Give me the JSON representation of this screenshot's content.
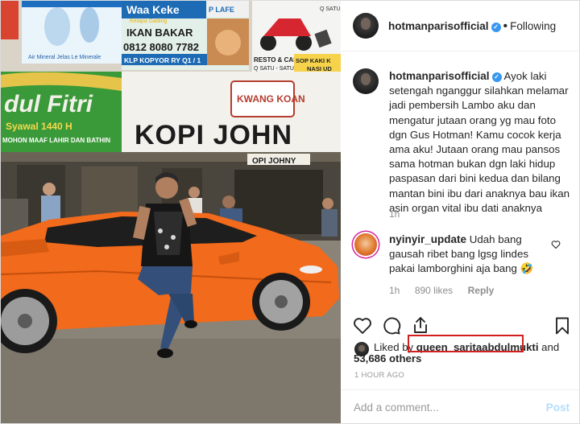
{
  "post": {
    "username": "hotmanparisofficial",
    "follow_state": "Following",
    "separator": "•",
    "caption": "Ayok laki setengah nganggur silahkan melamar jadi pembersih Lambo aku dan mengatur jutaan orang yg mau foto dgn Gus Hotman! Kamu cocok kerja ama aku! Jutaan orang mau pansos sama hotman bukan dgn laki hidup paspasan dari bini kedua dan bilang mantan bini ibu dari anaknya bau ikan asin organ vital ibu dati anaknya",
    "caption_time": "1h"
  },
  "comment": {
    "username": "nyinyir_update",
    "text": "Udah bang gausah ribet bang lgsg lindes pakai lamborghini aja bang",
    "emoji": "🤣",
    "time": "1h",
    "likes": "890 likes",
    "reply_label": "Reply"
  },
  "likes": {
    "prefix": "Liked by",
    "user": "queen_saritaabdulmukti",
    "connector": "and",
    "others": "53,686 others"
  },
  "timestamp": "1 HOUR AGO",
  "composer": {
    "placeholder": "Add a comment...",
    "post_label": "Post"
  },
  "photo": {
    "sign_top_1": "Waa Keke",
    "sign_top_2": "Kelapa Gading",
    "sign_top_3": "IKAN BAKAR",
    "sign_top_4": "0812 8080 7782",
    "sign_top_5": "KLP KOPYOR RY Q1 / 1",
    "sign_top_6": "Air Mineral Jelas Le Minerale",
    "sign_top_7": "RESTO & CAFE",
    "sign_top_8": "Q SATU - SATU",
    "sign_top_9": "SOP KAKI K",
    "sign_top_10": "NASI UD",
    "sign_top_11": "Q SATU",
    "sign_top_12": "P LAFE",
    "banner_1": "dul Fitri",
    "banner_2": "Syawal 1440 H",
    "banner_3": "MOHON MAAF LAHIR DAN BATHIN",
    "banner_4": "KOPI JOHN",
    "banner_5": "KWANG KOAN",
    "banner_6": "OPI JOHNY"
  },
  "colors": {
    "link": "#3897f0",
    "highlight_box": "#d21f1f",
    "car": "#f26a1b",
    "post_button": "#b2dffc"
  },
  "icons": [
    "heart-icon",
    "comment-icon",
    "share-icon",
    "bookmark-icon",
    "verified-icon",
    "small-heart-icon"
  ]
}
